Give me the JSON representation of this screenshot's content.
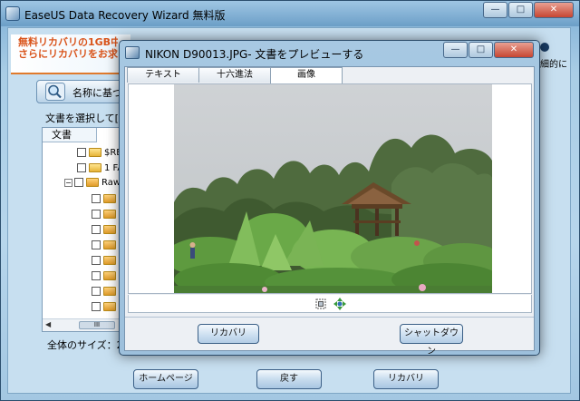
{
  "main": {
    "title": "EaseUS Data Recovery Wizard 無料版",
    "promo_line1": "無料リカバリの1GB中",
    "promo_line2": "さらにリカバリをお求め",
    "right_tail": "細的に",
    "search_label": "名称に基づ",
    "select_label": "文書を選択して[",
    "tree_tab": "文書",
    "tree_items": [
      {
        "label": "$RE",
        "type": "folder"
      },
      {
        "label": "1 FA",
        "type": "folder"
      },
      {
        "label": "Raw",
        "type": "raw"
      }
    ],
    "scroll_thumb": "III",
    "total_size": "全体のサイズ：2.",
    "buttons": {
      "home": "ホームページ",
      "back": "戻す",
      "recover": "リカバリ"
    }
  },
  "dialog": {
    "title": "NIKON D90013.JPG- 文書をプレビューする",
    "tabs": [
      {
        "label": "テキスト",
        "active": false
      },
      {
        "label": "十六進法",
        "active": false
      },
      {
        "label": "画像",
        "active": true
      }
    ],
    "buttons": {
      "recover": "リカバリ",
      "shutdown": "シャットダウン"
    }
  },
  "icons": {
    "minimize": "minimize-icon",
    "maximize": "maximize-icon",
    "close": "close-icon",
    "search": "magnifier-icon",
    "zoom_fit": "zoom-fit-icon",
    "move": "move-arrows-icon"
  },
  "colors": {
    "promo_text": "#d9541b",
    "close_button": "#c74632",
    "window_frame": "#9fc6e4"
  }
}
